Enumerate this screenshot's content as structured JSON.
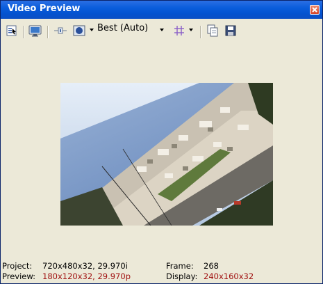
{
  "window": {
    "title": "Video Preview"
  },
  "toolbar": {
    "quality_label": "Best (Auto)"
  },
  "status": {
    "project_label": "Project:",
    "project_value": "720x480x32, 29.970i",
    "preview_label": "Preview:",
    "preview_value": "180x120x32, 29.970p",
    "frame_label": "Frame:",
    "frame_value": "268",
    "display_label": "Display:",
    "display_value": "240x160x32"
  },
  "colors": {
    "titlebar": "#0a5ddb",
    "window_bg": "#ece9d8",
    "status_highlight": "#a01010"
  }
}
